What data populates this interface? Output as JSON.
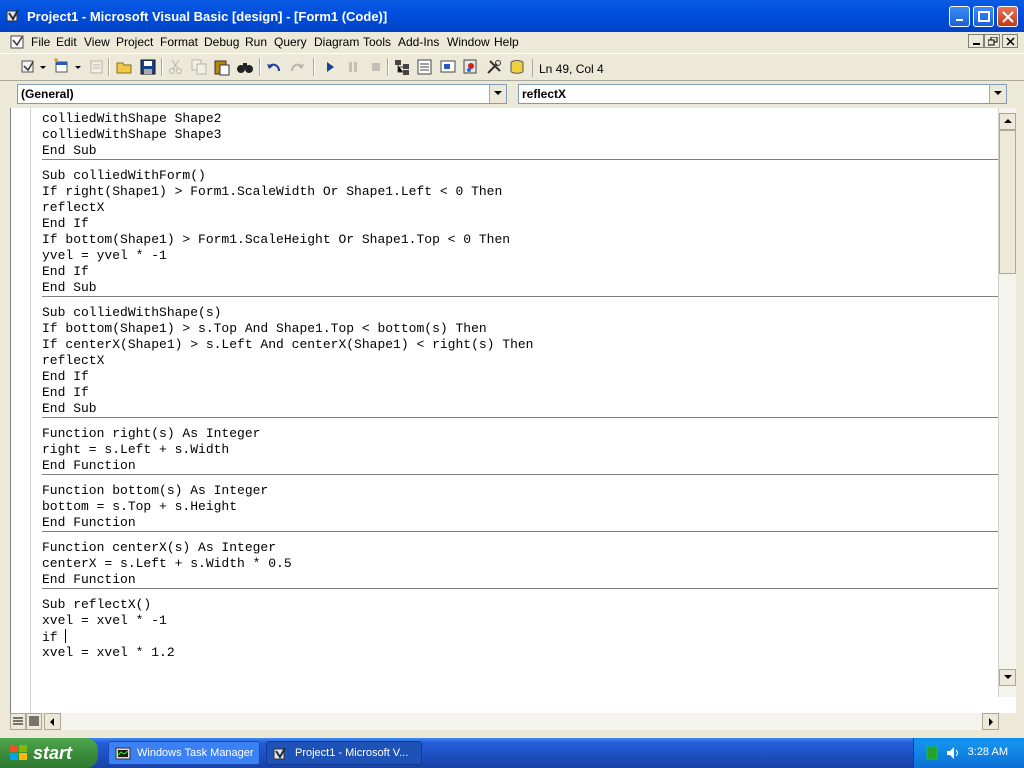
{
  "window": {
    "title": "Project1 - Microsoft Visual Basic [design] - [Form1 (Code)]"
  },
  "menu": {
    "items": [
      "File",
      "Edit",
      "View",
      "Project",
      "Format",
      "Debug",
      "Run",
      "Query",
      "Diagram",
      "Tools",
      "Add-Ins",
      "Window",
      "Help"
    ]
  },
  "toolbar": {
    "position": "Ln 49, Col 4"
  },
  "combos": {
    "object": "(General)",
    "procedure": "reflectX"
  },
  "code": {
    "procedures": [
      {
        "lines": [
          "colliedWithShape Shape2",
          "colliedWithShape Shape3",
          "End Sub"
        ]
      },
      {
        "lines": [
          "Sub colliedWithForm()",
          "If right(Shape1) > Form1.ScaleWidth Or Shape1.Left < 0 Then",
          "reflectX",
          "End If",
          "If bottom(Shape1) > Form1.ScaleHeight Or Shape1.Top < 0 Then",
          "yvel = yvel * -1",
          "End If",
          "End Sub"
        ]
      },
      {
        "lines": [
          "Sub colliedWithShape(s)",
          "If bottom(Shape1) > s.Top And Shape1.Top < bottom(s) Then",
          "If centerX(Shape1) > s.Left And centerX(Shape1) < right(s) Then",
          "reflectX",
          "End If",
          "End If",
          "End Sub"
        ]
      },
      {
        "lines": [
          "Function right(s) As Integer",
          "right = s.Left + s.Width",
          "End Function"
        ]
      },
      {
        "lines": [
          "Function bottom(s) As Integer",
          "bottom = s.Top + s.Height",
          "End Function"
        ]
      },
      {
        "lines": [
          "Function centerX(s) As Integer",
          "centerX = s.Left + s.Width * 0.5",
          "End Function"
        ]
      },
      {
        "lines": [
          "Sub reflectX()",
          "xvel = xvel * -1",
          "if ",
          "xvel = xvel * 1.2"
        ]
      }
    ]
  },
  "taskbar": {
    "start_label": "start",
    "tasks": [
      "Windows Task Manager",
      "Project1 - Microsoft V..."
    ],
    "clock": "3:28 AM"
  }
}
